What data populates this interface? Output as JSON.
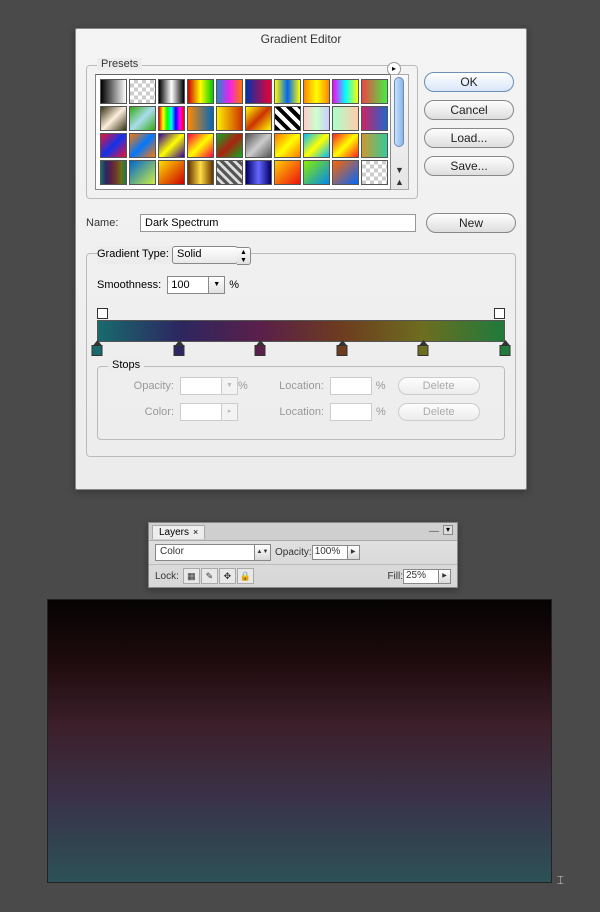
{
  "gradientEditor": {
    "title": "Gradient Editor",
    "presets": {
      "label": "Presets"
    },
    "buttons": {
      "ok": "OK",
      "cancel": "Cancel",
      "load": "Load...",
      "save": "Save...",
      "new": "New"
    },
    "name": {
      "label": "Name:",
      "value": "Dark Spectrum"
    },
    "gradientType": {
      "label": "Gradient Type:",
      "value": "Solid"
    },
    "smoothness": {
      "label": "Smoothness:",
      "value": "100",
      "unit": "%"
    },
    "gradientBar": {
      "colorStops": [
        {
          "pos": 0,
          "color": "#186a6d"
        },
        {
          "pos": 20,
          "color": "#2c2760"
        },
        {
          "pos": 40,
          "color": "#5a1f4a"
        },
        {
          "pos": 60,
          "color": "#6d3c1f"
        },
        {
          "pos": 80,
          "color": "#6d6d1f"
        },
        {
          "pos": 100,
          "color": "#1f7a3c"
        }
      ]
    },
    "stops": {
      "label": "Stops",
      "opacity": {
        "label": "Opacity:",
        "unit": "%"
      },
      "location": {
        "label": "Location:",
        "unit": "%"
      },
      "color": {
        "label": "Color:"
      },
      "delete": "Delete"
    },
    "presetSwatches": [
      [
        "linear-gradient(90deg,#000,#fff)",
        "repeating-conic-gradient(#ccc 0 25%,#fff 0 50%) 0/8px 8px",
        "linear-gradient(90deg,#000,#fff,#000)",
        "linear-gradient(90deg,#c00,#ff0,#0c0)",
        "linear-gradient(90deg,#28c,#e2e,#f70)",
        "linear-gradient(90deg,#03a,#e03)",
        "linear-gradient(90deg,#ff0,#06e,#ff0)",
        "linear-gradient(90deg,#f80,#ff0,#f80)",
        "linear-gradient(90deg,#f0f,#0ff,#ff0)",
        "linear-gradient(90deg,#e44,#4e4)"
      ],
      [
        "linear-gradient(135deg,#331,#fed,#331)",
        "linear-gradient(135deg,#3a1,#ade,#3a1)",
        "linear-gradient(90deg,#f00,#ff0,#0f0,#0ff,#00f,#f0f,#f00)",
        "linear-gradient(90deg,#f80,#06b)",
        "linear-gradient(90deg,#fe0,#c30)",
        "linear-gradient(135deg,#ff0,#c30,#ff0)",
        "repeating-linear-gradient(45deg,#000 0 4px,#fff 4px 8px)",
        "linear-gradient(90deg,#fcc,#cfc,#ccf)",
        "linear-gradient(90deg,#afc,#fca)",
        "linear-gradient(90deg,#c26,#26c)"
      ],
      [
        "linear-gradient(135deg,#e13,#13e,#e13)",
        "linear-gradient(135deg,#f70,#07f,#f70)",
        "linear-gradient(135deg,#309,#ff0,#309)",
        "linear-gradient(135deg,#f04,#ff0,#f04)",
        "linear-gradient(135deg,#1a2,#a21,#1a2)",
        "linear-gradient(135deg,#555,#ccc,#555)",
        "linear-gradient(135deg,#f70,#ff0,#f70)",
        "linear-gradient(135deg,#0bf,#ff0,#0bf)",
        "linear-gradient(135deg,#f22,#ff0,#f22)",
        "linear-gradient(90deg,#c93,#3c9)"
      ],
      [
        "linear-gradient(90deg,#186a6d,#2c2760,#5a1f4a,#6d3c1f,#6d6d1f,#1f7a3c)",
        "linear-gradient(135deg,#06c,#ce4)",
        "linear-gradient(135deg,#fd0,#c00)",
        "linear-gradient(90deg,#630,#fd4,#630)",
        "repeating-linear-gradient(45deg,#555 0 3px,#ddd 3px 6px)",
        "linear-gradient(90deg,#006,#66f,#006)",
        "linear-gradient(135deg,#fc0,#e11)",
        "linear-gradient(135deg,#8e0,#08e)",
        "linear-gradient(135deg,#f60,#06f)",
        "repeating-conic-gradient(#ccc 0 25%,#fff 0 50%) 0/8px 8px"
      ]
    ]
  },
  "layersPanel": {
    "tab": "Layers",
    "blend": {
      "value": "Color"
    },
    "opacity": {
      "label": "Opacity:",
      "value": "100%"
    },
    "lock": {
      "label": "Lock:"
    },
    "fill": {
      "label": "Fill:",
      "value": "25%"
    }
  }
}
